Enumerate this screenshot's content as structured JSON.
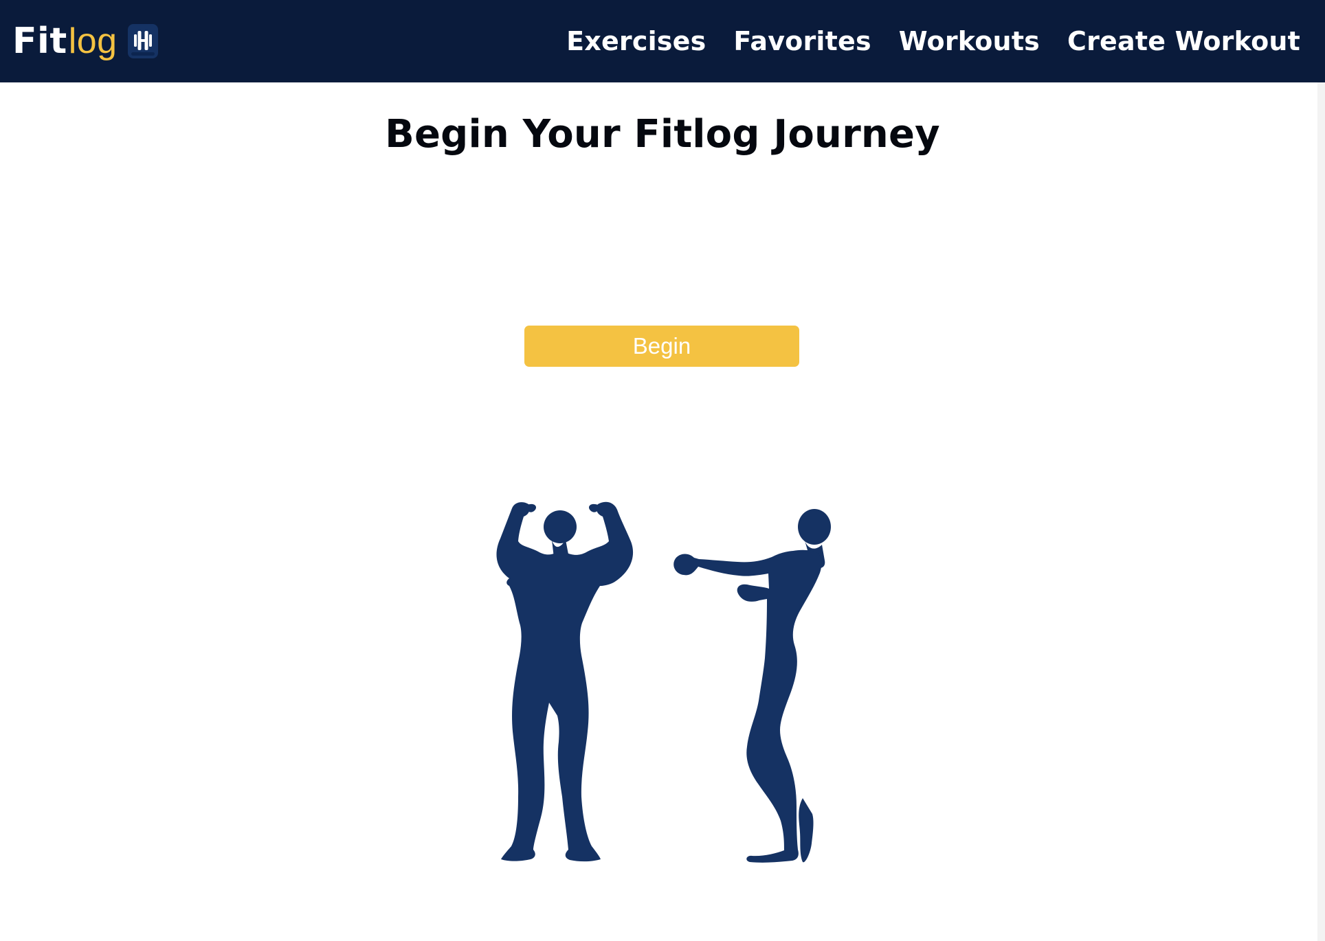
{
  "header": {
    "brand": {
      "primary": "Fit",
      "secondary": "log",
      "icon": "dumbbell-icon"
    },
    "nav": [
      {
        "label": "Exercises"
      },
      {
        "label": "Favorites"
      },
      {
        "label": "Workouts"
      },
      {
        "label": "Create Workout"
      }
    ]
  },
  "main": {
    "title": "Begin Your Fitlog Journey",
    "begin_button_label": "Begin",
    "illustration": "bodybuilders-silhouette"
  },
  "colors": {
    "navbar_background": "#0a1b3b",
    "accent": "#f4c242",
    "silhouette": "#153263",
    "title_text": "#05080f"
  }
}
